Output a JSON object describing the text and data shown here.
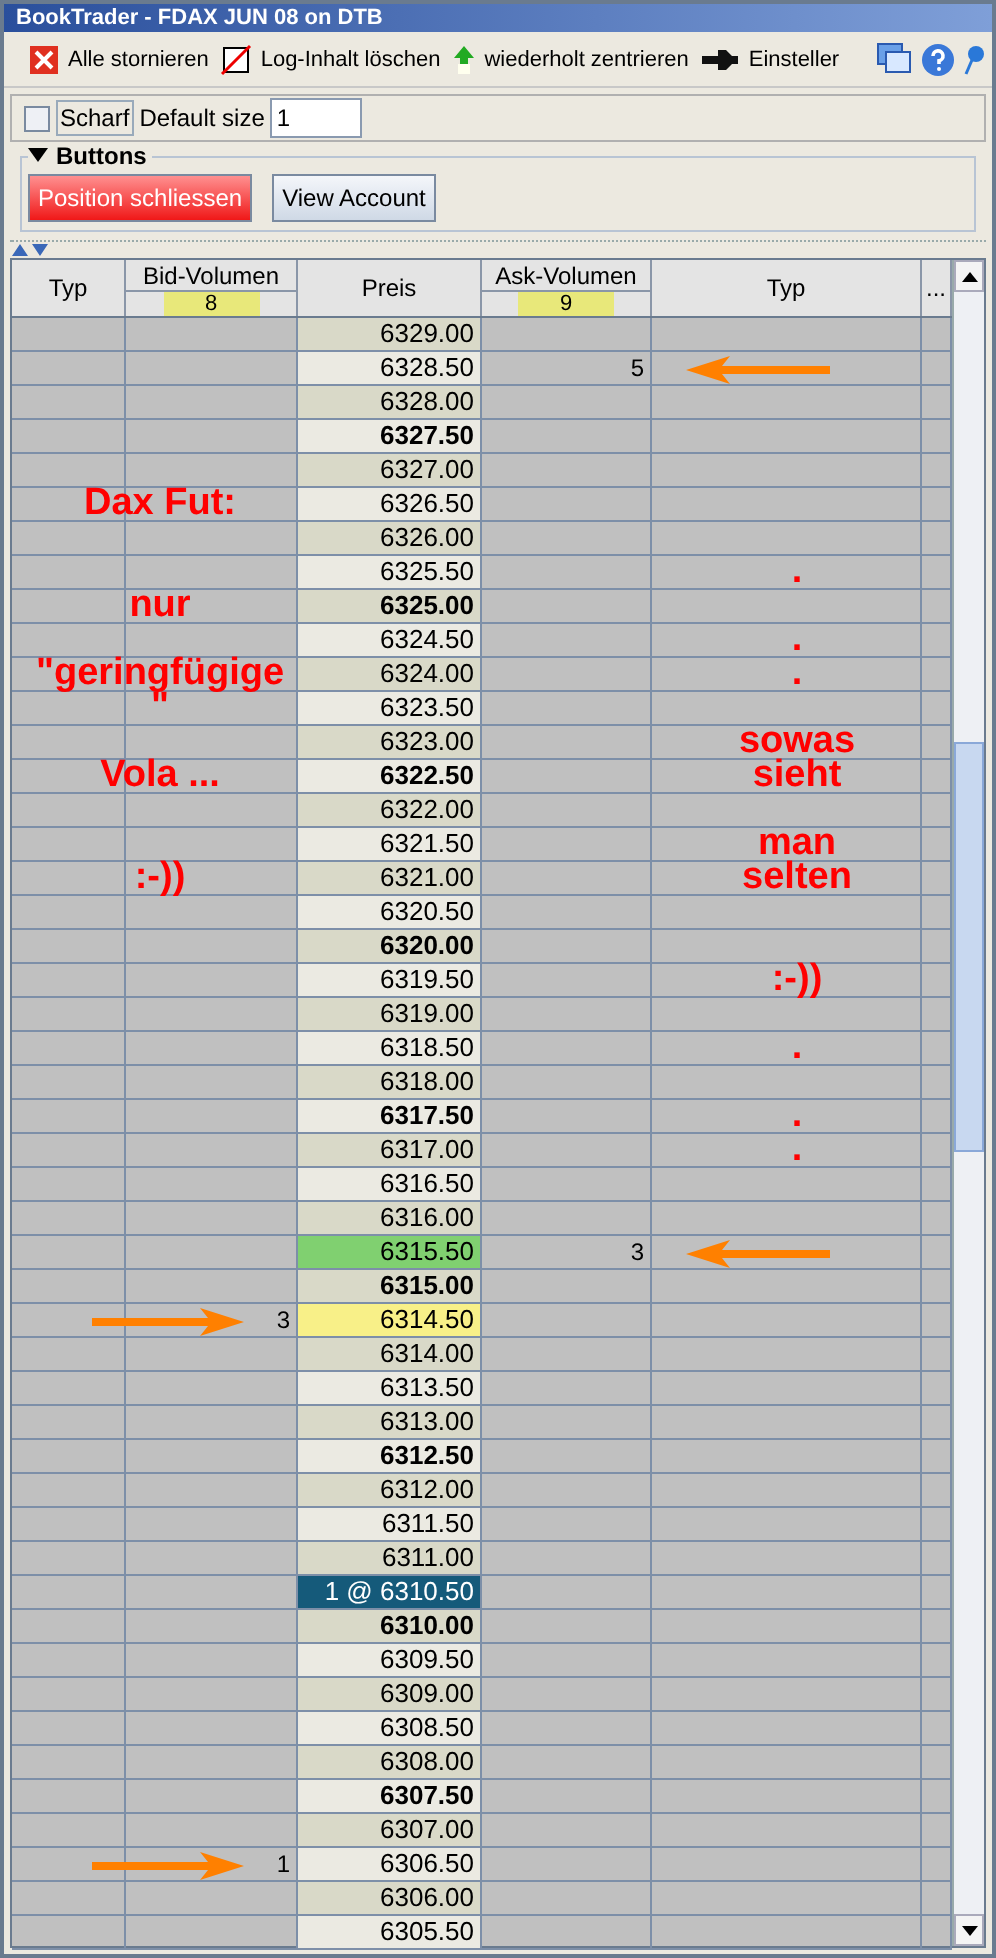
{
  "window": {
    "title": "BookTrader - FDAX JUN 08 on DTB"
  },
  "toolbar": [
    {
      "kind": "cancel",
      "label": "Alle stornieren"
    },
    {
      "kind": "clear",
      "label": "Log-Inhalt löschen"
    },
    {
      "kind": "center",
      "label": "wiederholt zentrieren"
    },
    {
      "kind": "settings",
      "label": "Einsteller"
    }
  ],
  "options": {
    "checkbox_label": "Scharf",
    "checked": false,
    "size_label": "Default size",
    "size_value": "1"
  },
  "buttons_panel": {
    "title": "Buttons",
    "expanded": true,
    "buttons": [
      {
        "kind": "danger",
        "label": "Position schliessen"
      },
      {
        "kind": "normal",
        "label": "View Account"
      }
    ]
  },
  "table": {
    "columns": [
      {
        "label": "Typ"
      },
      {
        "label": "Bid-Volumen",
        "total": "8"
      },
      {
        "label": "Preis"
      },
      {
        "label": "Ask-Volumen",
        "total": "9"
      },
      {
        "label": "Typ"
      },
      {
        "label": "..."
      }
    ],
    "rows": [
      {
        "price": "6329.00",
        "bold": false,
        "shaded": true,
        "arrow": false
      },
      {
        "price": "6328.50",
        "bold": false,
        "shaded": false,
        "ask": "5",
        "arrow": true
      },
      {
        "price": "6328.00",
        "bold": false,
        "shaded": true,
        "arrow": false
      },
      {
        "price": "6327.50",
        "bold": true,
        "shaded": false,
        "arrow": false
      },
      {
        "price": "6327.00",
        "bold": false,
        "shaded": true,
        "arrow": false
      },
      {
        "price": "6326.50",
        "bold": false,
        "shaded": false,
        "arrow": false,
        "left_note": "Dax Fut:"
      },
      {
        "price": "6326.00",
        "bold": false,
        "shaded": true,
        "arrow": false
      },
      {
        "price": "6325.50",
        "bold": false,
        "shaded": false,
        "arrow": false,
        "right_note": "."
      },
      {
        "price": "6325.00",
        "bold": true,
        "shaded": true,
        "arrow": false,
        "left_note": "nur"
      },
      {
        "price": "6324.50",
        "bold": false,
        "shaded": false,
        "arrow": false,
        "right_note": "."
      },
      {
        "price": "6324.00",
        "bold": false,
        "shaded": true,
        "arrow": false,
        "left_note": "\"geringfügige",
        "right_note": "."
      },
      {
        "price": "6323.50",
        "bold": false,
        "shaded": false,
        "arrow": false,
        "left_note": "\""
      },
      {
        "price": "6323.00",
        "bold": false,
        "shaded": true,
        "arrow": false,
        "right_note": "sowas"
      },
      {
        "price": "6322.50",
        "bold": true,
        "shaded": false,
        "arrow": false,
        "left_note": "Vola ...",
        "right_note": "sieht"
      },
      {
        "price": "6322.00",
        "bold": false,
        "shaded": true,
        "arrow": false
      },
      {
        "price": "6321.50",
        "bold": false,
        "shaded": false,
        "arrow": false,
        "right_note": "man"
      },
      {
        "price": "6321.00",
        "bold": false,
        "shaded": true,
        "arrow": false,
        "left_note": ":-))",
        "right_note": "selten"
      },
      {
        "price": "6320.50",
        "bold": false,
        "shaded": false,
        "arrow": false
      },
      {
        "price": "6320.00",
        "bold": true,
        "shaded": true,
        "arrow": false
      },
      {
        "price": "6319.50",
        "bold": false,
        "shaded": false,
        "arrow": false,
        "right_note": ":-))"
      },
      {
        "price": "6319.00",
        "bold": false,
        "shaded": true,
        "arrow": false
      },
      {
        "price": "6318.50",
        "bold": false,
        "shaded": false,
        "arrow": false,
        "right_note": "."
      },
      {
        "price": "6318.00",
        "bold": false,
        "shaded": true,
        "arrow": false
      },
      {
        "price": "6317.50",
        "bold": true,
        "shaded": false,
        "arrow": false,
        "right_note": "."
      },
      {
        "price": "6317.00",
        "bold": false,
        "shaded": true,
        "arrow": false,
        "right_note": "."
      },
      {
        "price": "6316.50",
        "bold": false,
        "shaded": false,
        "arrow": false
      },
      {
        "price": "6316.00",
        "bold": false,
        "shaded": true,
        "arrow": false
      },
      {
        "price": "6315.50",
        "bold": false,
        "color": "#80d070",
        "ask": "3",
        "arrow": true
      },
      {
        "price": "6315.00",
        "bold": true,
        "shaded": true,
        "arrow": false
      },
      {
        "price": "6314.50",
        "bold": false,
        "color": "#f8f088",
        "bid": "3",
        "arrow": true
      },
      {
        "price": "6314.00",
        "bold": false,
        "shaded": true,
        "arrow": false
      },
      {
        "price": "6313.50",
        "bold": false,
        "shaded": false,
        "arrow": false
      },
      {
        "price": "6313.00",
        "bold": false,
        "shaded": true,
        "arrow": false
      },
      {
        "price": "6312.50",
        "bold": true,
        "shaded": false,
        "arrow": false
      },
      {
        "price": "6312.00",
        "bold": false,
        "shaded": true,
        "arrow": false
      },
      {
        "price": "6311.50",
        "bold": false,
        "shaded": false,
        "arrow": false
      },
      {
        "price": "6311.00",
        "bold": false,
        "shaded": true,
        "arrow": false
      },
      {
        "price": "1 @ 6310.50",
        "bold": false,
        "color": "#155a7a",
        "arrow": false
      },
      {
        "price": "6310.00",
        "bold": true,
        "shaded": true,
        "arrow": false
      },
      {
        "price": "6309.50",
        "bold": false,
        "shaded": false,
        "arrow": false
      },
      {
        "price": "6309.00",
        "bold": false,
        "shaded": true,
        "arrow": false
      },
      {
        "price": "6308.50",
        "bold": false,
        "shaded": false,
        "arrow": false
      },
      {
        "price": "6308.00",
        "bold": false,
        "shaded": true,
        "arrow": false
      },
      {
        "price": "6307.50",
        "bold": true,
        "shaded": false,
        "arrow": false
      },
      {
        "price": "6307.00",
        "bold": false,
        "shaded": true,
        "arrow": false
      },
      {
        "price": "6306.50",
        "bold": false,
        "shaded": false,
        "bid": "1",
        "arrow": true
      },
      {
        "price": "6306.00",
        "bold": false,
        "shaded": true,
        "arrow": false
      },
      {
        "price": "6305.50",
        "bold": false,
        "shaded": false,
        "arrow": false
      }
    ]
  }
}
